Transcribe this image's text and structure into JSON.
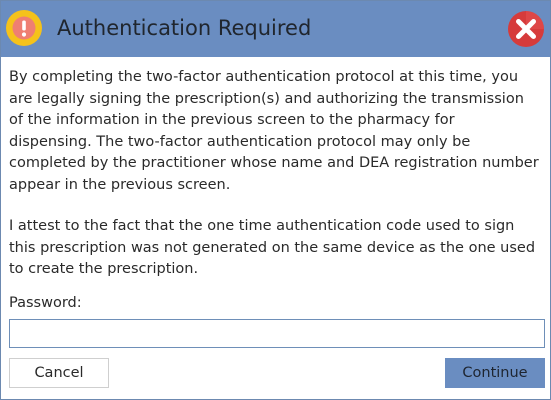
{
  "dialog": {
    "title": "Authentication Required",
    "title_icon": "warning-exclamation-icon",
    "close_icon": "close-x-icon",
    "colors": {
      "titlebar": "#6a8dc1",
      "warning_icon": "#f0c020",
      "close_icon": "#d93a3a",
      "primary_button": "#6a8dc1"
    }
  },
  "body": {
    "paragraph1": "By completing the two-factor authentication protocol at this time, you are legally signing the prescription(s) and authorizing the transmission of the information in the previous screen to the pharmacy for dispensing. The two-factor authentication protocol may only be completed by the practitioner whose name and DEA registration number appear in the previous screen.",
    "paragraph2": "I attest to the fact that the one time authentication code used to sign this prescription was not generated on the same device as the one used to create the prescription."
  },
  "password": {
    "label": "Password:",
    "value": ""
  },
  "buttons": {
    "cancel": "Cancel",
    "continue": "Continue"
  }
}
